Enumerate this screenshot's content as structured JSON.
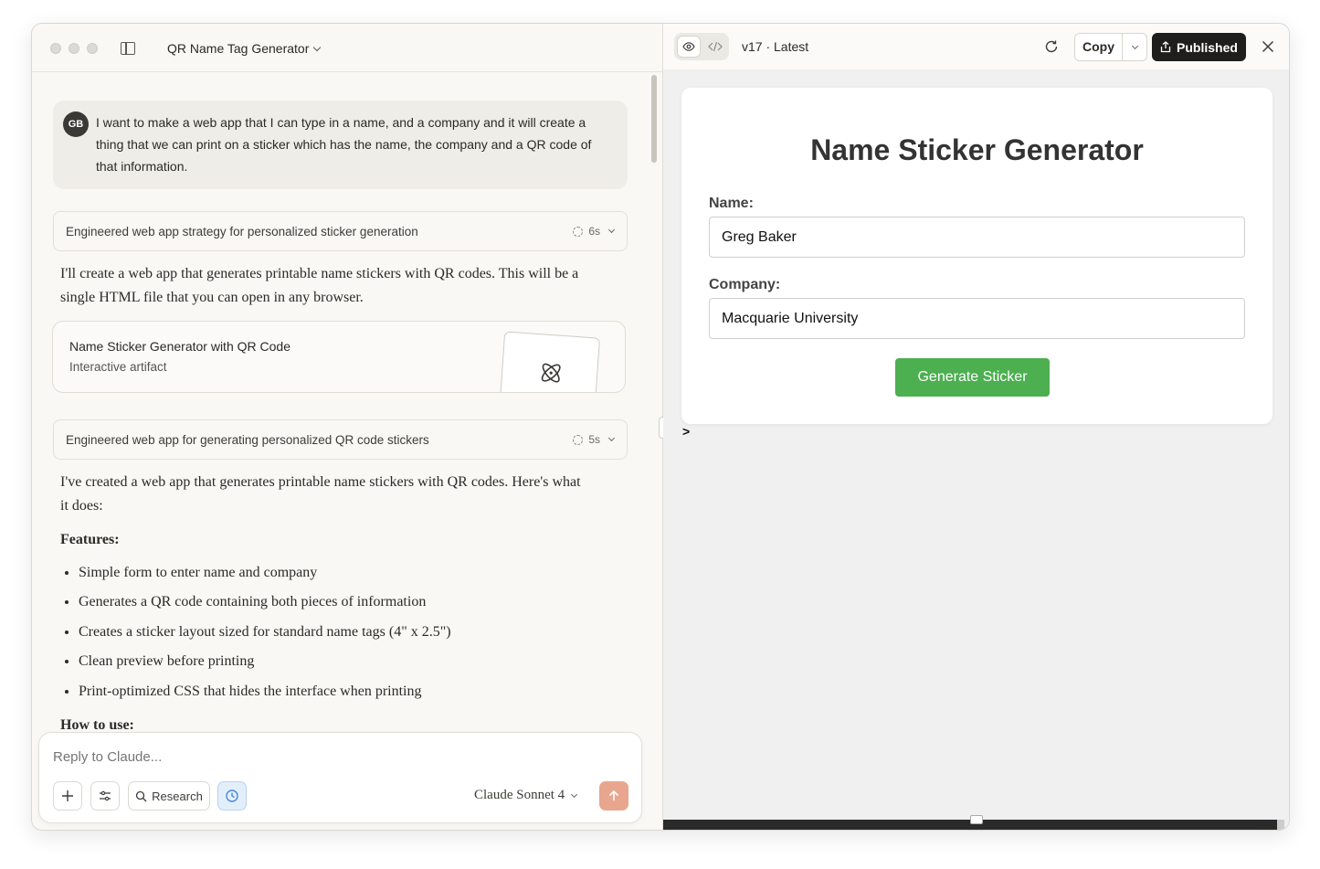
{
  "window": {
    "project_title": "QR Name Tag Generator"
  },
  "chat": {
    "user_initials": "GB",
    "user_message": "I want to make a web app that I can type in a name, and a company and it will create a thing that we can print on a sticker which has the name, the company and a QR code of that information.",
    "thinking_1": {
      "label": "Engineered web app strategy for personalized sticker generation",
      "duration": "6s"
    },
    "reply_1": "I'll create a web app that generates printable name stickers with QR codes. This will be a single HTML file that you can open in any browser.",
    "artifact": {
      "title": "Name Sticker Generator with QR Code",
      "subtitle": "Interactive artifact",
      "icon": "atom-icon"
    },
    "thinking_2": {
      "label": "Engineered web app for generating personalized QR code stickers",
      "duration": "5s"
    },
    "reply_2": "I've created a web app that generates printable name stickers with QR codes. Here's what it does:",
    "features_heading": "Features:",
    "features": [
      "Simple form to enter name and company",
      "Generates a QR code containing both pieces of information",
      "Creates a sticker layout sized for standard name tags (4\" x 2.5\")",
      "Clean preview before printing",
      "Print-optimized CSS that hides the interface when printing"
    ],
    "how_to_heading": "How to use:"
  },
  "composer": {
    "placeholder": "Reply to Claude...",
    "research_label": "Research",
    "model_label": "Claude Sonnet 4"
  },
  "artifact_panel": {
    "version_label": "v17 · Latest",
    "copy_label": "Copy",
    "publish_label": "Published"
  },
  "preview": {
    "title": "Name Sticker Generator",
    "name_label": "Name:",
    "name_value": "Greg Baker",
    "company_label": "Company:",
    "company_value": "Macquarie University",
    "generate_label": "Generate Sticker",
    "prompt_char": ">"
  },
  "colors": {
    "accent_green": "#4caf50",
    "send_button": "#e8a68f",
    "publish_button": "#1f1e1c",
    "research_active": "#e3eefb"
  }
}
